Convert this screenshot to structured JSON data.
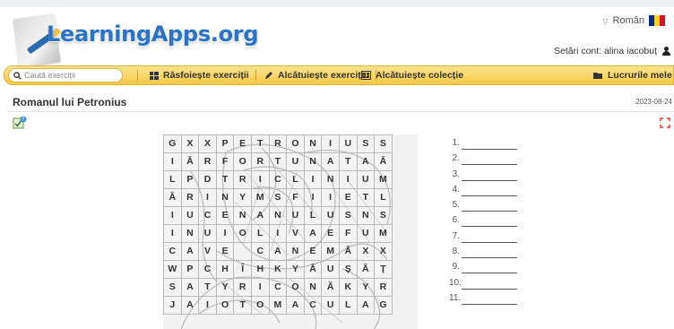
{
  "site": {
    "logo_text": "LearningApps.org"
  },
  "header": {
    "language": "Român",
    "account_label": "Setări cont: alina iacobuț",
    "flag_colors": [
      "#002b7f",
      "#fcd116",
      "#ce1126"
    ]
  },
  "nav": {
    "search_placeholder": "Caută exerciții",
    "browse": "Răsfoiește exerciții",
    "create": "Alcătuiește exercițiu",
    "collection": "Alcătuiește colecție",
    "my_apps": "Lucrurile mele"
  },
  "page": {
    "title": "Romanul lui Petronius",
    "date": "2023-08-24"
  },
  "puzzle": {
    "rows": [
      [
        "G",
        "X",
        "X",
        "P",
        "E",
        "T",
        "R",
        "O",
        "N",
        "I",
        "U",
        "S",
        "S"
      ],
      [
        "I",
        "Ă",
        "R",
        "F",
        "O",
        "R",
        "T",
        "U",
        "N",
        "A",
        "T",
        "A",
        "Ă"
      ],
      [
        "L",
        "P",
        "D",
        "T",
        "R",
        "I",
        "C",
        "L",
        "I",
        "N",
        "I",
        "U",
        "M"
      ],
      [
        "Ă",
        "R",
        "I",
        "N",
        "Y",
        "M",
        "S",
        "F",
        "I",
        "I",
        "E",
        "T",
        "L"
      ],
      [
        "I",
        "U",
        "C",
        "E",
        "N",
        "A",
        "N",
        "U",
        "L",
        "U",
        "S",
        "N",
        "S"
      ],
      [
        "I",
        "N",
        "U",
        "I",
        "O",
        "L",
        "I",
        "V",
        "A",
        "E",
        "F",
        "U",
        "M"
      ],
      [
        "C",
        "A",
        "V",
        "E",
        "",
        "C",
        "A",
        "N",
        "E",
        "M",
        "Ă",
        "X",
        "X"
      ],
      [
        "W",
        "P",
        "C",
        "H",
        "Î",
        "H",
        "K",
        "Y",
        "Ă",
        "U",
        "Ș",
        "Ă",
        "Ț"
      ],
      [
        "S",
        "A",
        "T",
        "Y",
        "R",
        "I",
        "C",
        "O",
        "N",
        "Ă",
        "K",
        "Y",
        "R"
      ],
      [
        "J",
        "A",
        "I",
        "O",
        "T",
        "O",
        "M",
        "A",
        "C",
        "U",
        "L",
        "A",
        "G"
      ]
    ],
    "answer_numbers": [
      "1.",
      "2.",
      "3.",
      "4.",
      "5.",
      "6.",
      "7.",
      "8.",
      "9.",
      "10.",
      "11."
    ]
  },
  "colors": {
    "accent": "#2a73c9",
    "nav_bg": "#f6c946"
  },
  "icons": [
    "search-icon",
    "grid-icon",
    "pencil-icon",
    "collection-icon",
    "folder-icon",
    "user-icon",
    "help-icon",
    "expand-icon",
    "caret-icon"
  ]
}
